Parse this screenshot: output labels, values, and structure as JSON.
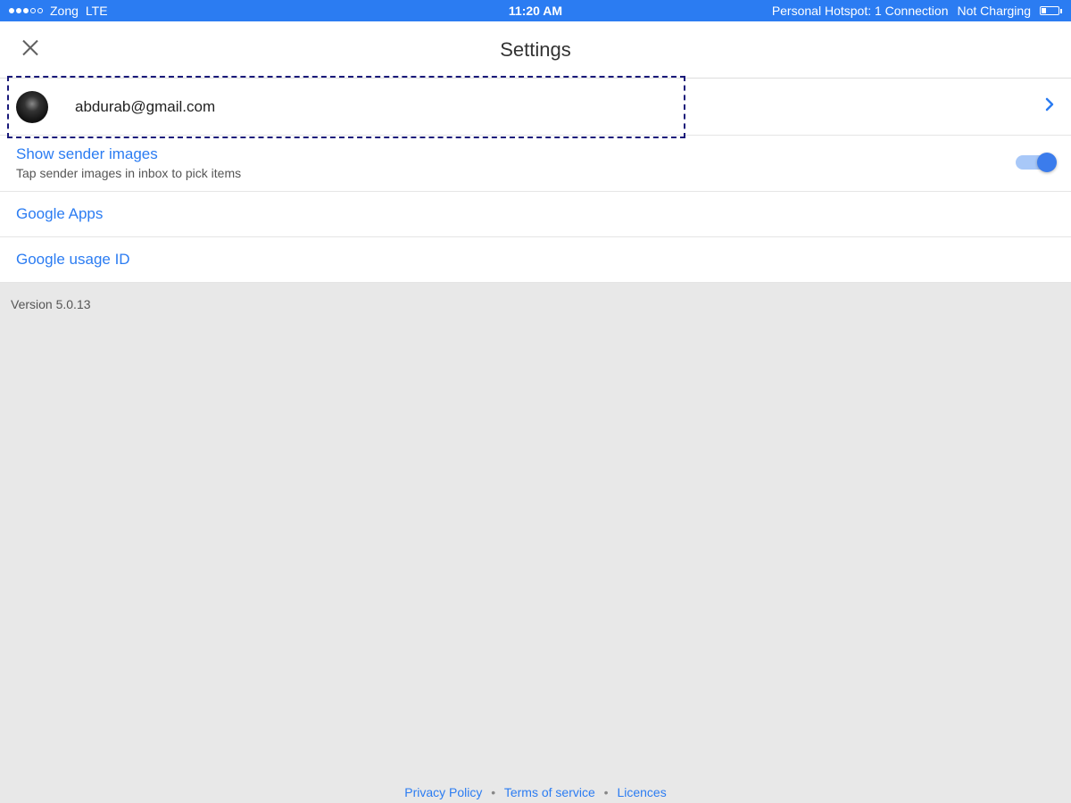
{
  "statusbar": {
    "carrier": "Zong",
    "network": "LTE",
    "time": "11:20 AM",
    "hotspot": "Personal Hotspot: 1 Connection",
    "charging": "Not Charging"
  },
  "nav": {
    "title": "Settings"
  },
  "account": {
    "email": "abdurab@gmail.com"
  },
  "settings": {
    "show_sender_images": {
      "title": "Show sender images",
      "subtitle": "Tap sender images in inbox to pick items",
      "enabled": true
    },
    "google_apps": {
      "title": "Google Apps"
    },
    "google_usage_id": {
      "title": "Google usage ID"
    }
  },
  "version": "Version 5.0.13",
  "footer": {
    "privacy": "Privacy Policy",
    "terms": "Terms of service",
    "licences": "Licences"
  }
}
